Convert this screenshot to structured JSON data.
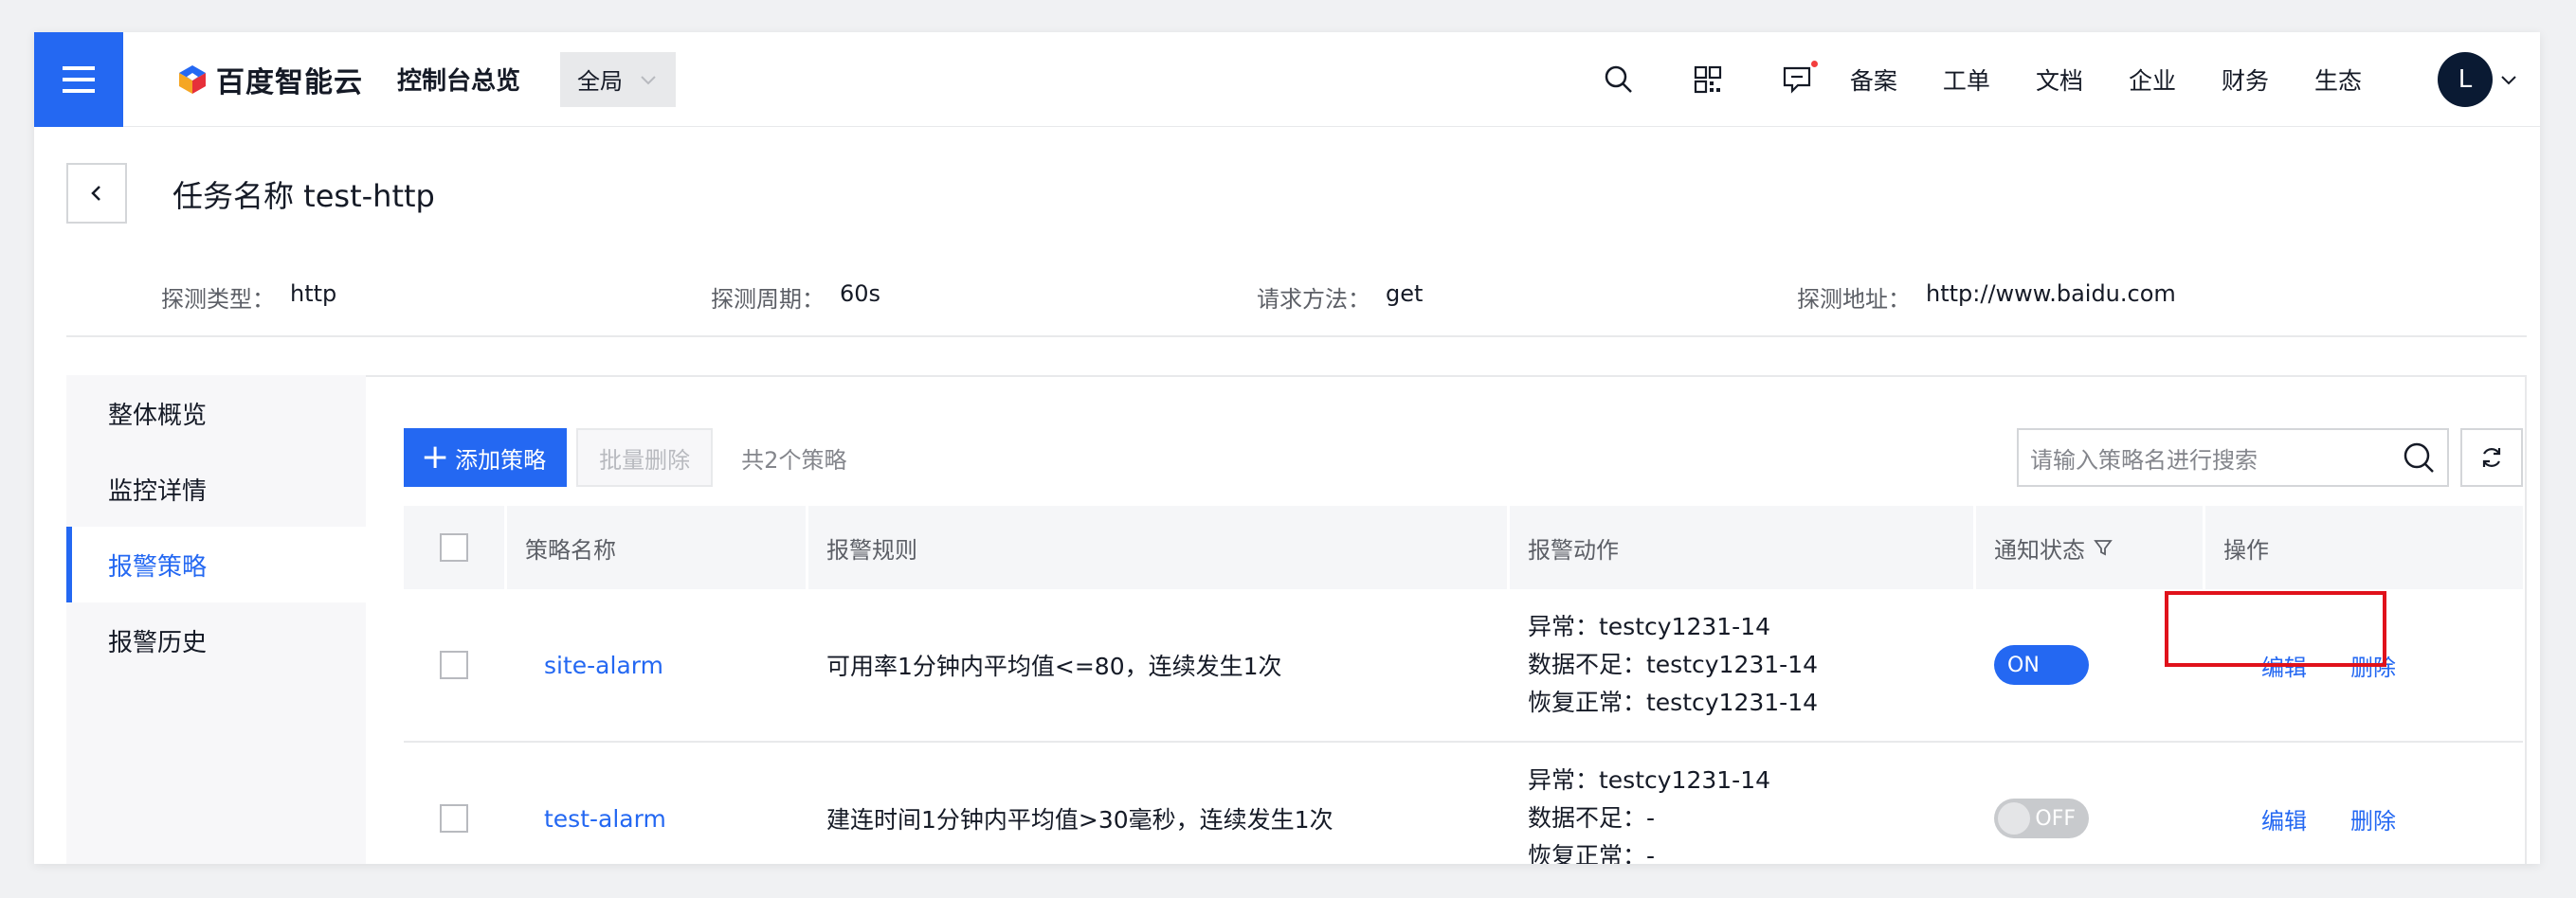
{
  "topbar": {
    "brand": "百度智能云",
    "console_title": "控制台总览",
    "region": "全局",
    "links": [
      "备案",
      "工单",
      "文档",
      "企业",
      "财务",
      "生态"
    ],
    "avatar_letter": "L",
    "colors": {
      "primary": "#2468f2",
      "badge": "#f33e3e"
    }
  },
  "header": {
    "title": "任务名称 test-http",
    "info": [
      {
        "key": "探测类型：",
        "value": "http"
      },
      {
        "key": "探测周期：",
        "value": "60s"
      },
      {
        "key": "请求方法：",
        "value": "get"
      },
      {
        "key": "探测地址：",
        "value": "http://www.baidu.com"
      }
    ]
  },
  "sidenav": {
    "items": [
      "整体概览",
      "监控详情",
      "报警策略",
      "报警历史"
    ],
    "active": "报警策略"
  },
  "toolbar": {
    "add_label": "添加策略",
    "batch_delete_label": "批量删除",
    "count_text": "共2个策略",
    "search_placeholder": "请输入策略名进行搜索"
  },
  "table": {
    "columns": [
      "策略名称",
      "报警规则",
      "报警动作",
      "通知状态",
      "操作"
    ],
    "rows": [
      {
        "name": "site-alarm",
        "rule": "可用率1分钟内平均值<=80，连续发生1次",
        "actions": [
          "异常：testcy1231-14",
          "数据不足：testcy1231-14",
          "恢复正常：testcy1231-14"
        ],
        "status": "ON",
        "ops": [
          "编辑",
          "删除"
        ]
      },
      {
        "name": "test-alarm",
        "rule": "建连时间1分钟内平均值>30毫秒，连续发生1次",
        "actions": [
          "异常：testcy1231-14",
          "数据不足：-",
          "恢复正常：-"
        ],
        "status": "OFF",
        "ops": [
          "编辑",
          "删除"
        ]
      }
    ]
  }
}
